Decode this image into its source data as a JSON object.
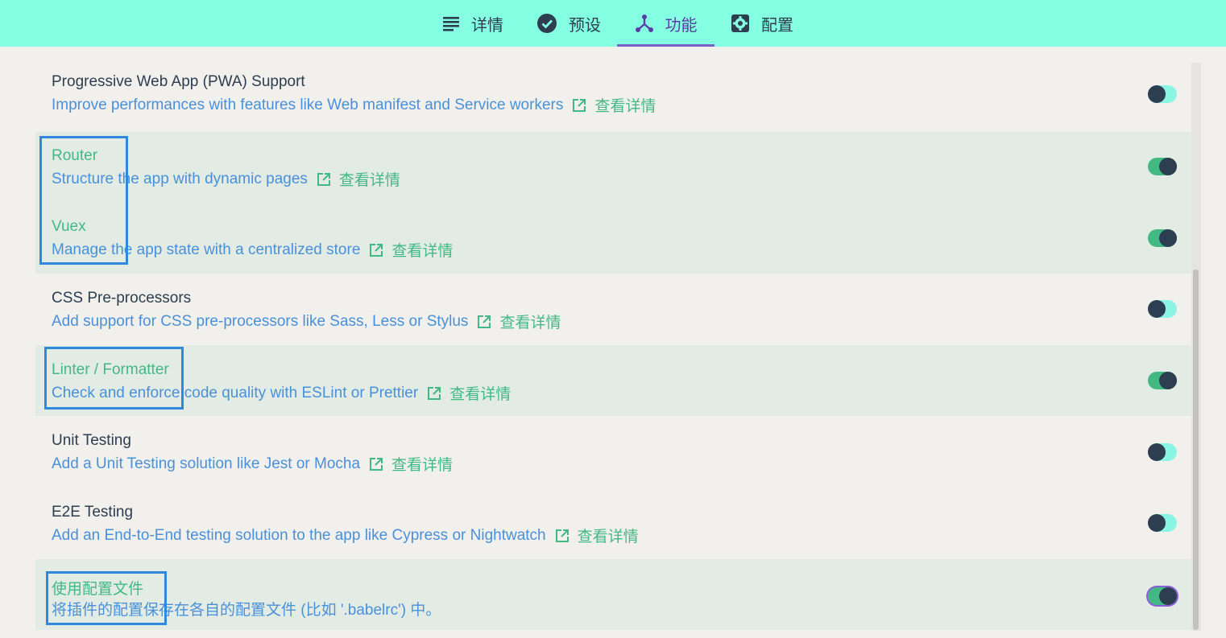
{
  "tabs": [
    {
      "label": "详情",
      "icon": "list-icon"
    },
    {
      "label": "预设",
      "icon": "check-circle-icon"
    },
    {
      "label": "功能",
      "icon": "fork-icon",
      "active": true
    },
    {
      "label": "配置",
      "icon": "gear-icon"
    }
  ],
  "more_label": "查看详情",
  "features": [
    {
      "name": "Progressive Web App (PWA) Support",
      "description": "Improve performances with features like Web manifest and Service workers",
      "enabled": false
    },
    {
      "name": "Router",
      "description": "Structure the app with dynamic pages",
      "enabled": true
    },
    {
      "name": "Vuex",
      "description": "Manage the app state with a centralized store",
      "enabled": true
    },
    {
      "name": "CSS Pre-processors",
      "description": "Add support for CSS pre-processors like Sass, Less or Stylus",
      "enabled": false
    },
    {
      "name": "Linter / Formatter",
      "description": "Check and enforce code quality with ESLint or Prettier",
      "enabled": true
    },
    {
      "name": "Unit Testing",
      "description": "Add a Unit Testing solution like Jest or Mocha",
      "enabled": false
    },
    {
      "name": "E2E Testing",
      "description": "Add an End-to-End testing solution to the app like Cypress or Nightwatch",
      "enabled": false
    },
    {
      "name": "使用配置文件",
      "description": "将插件的配置保存在各自的配置文件 (比如 '.babelrc') 中。",
      "enabled": true
    }
  ],
  "colors": {
    "header": "#84ffe1",
    "accent_green": "#42b983",
    "link_blue": "#4a90d9",
    "active_tab": "#5b3da6",
    "enabled_row": "#e2ece4"
  }
}
